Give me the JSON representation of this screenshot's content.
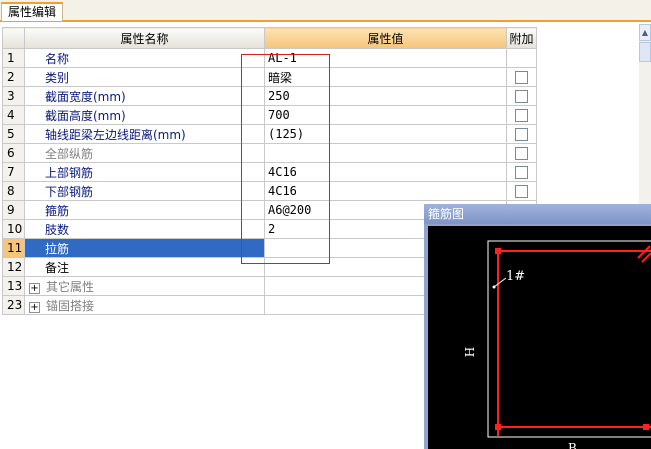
{
  "tab": {
    "label": "属性编辑"
  },
  "grid": {
    "headers": {
      "name": "属性名称",
      "value": "属性值",
      "add": "附加"
    },
    "rows": [
      {
        "num": "1",
        "name": "名称",
        "value": "AL-1"
      },
      {
        "num": "2",
        "name": "类别",
        "value": "暗梁"
      },
      {
        "num": "3",
        "name": "截面宽度(mm)",
        "value": "250"
      },
      {
        "num": "4",
        "name": "截面高度(mm)",
        "value": "700"
      },
      {
        "num": "5",
        "name": "轴线距梁左边线距离(mm)",
        "value": "(125)"
      },
      {
        "num": "6",
        "name": "全部纵筋",
        "value": ""
      },
      {
        "num": "7",
        "name": "上部钢筋",
        "value": "4C16"
      },
      {
        "num": "8",
        "name": "下部钢筋",
        "value": "4C16"
      },
      {
        "num": "9",
        "name": "箍筋",
        "value": "A6@200"
      },
      {
        "num": "10",
        "name": "肢数",
        "value": "2"
      },
      {
        "num": "11",
        "name": "拉筋",
        "value": ""
      },
      {
        "num": "12",
        "name": "备注",
        "value": ""
      },
      {
        "num": "13",
        "name": "其它属性",
        "value": ""
      },
      {
        "num": "23",
        "name": "锚固搭接",
        "value": ""
      }
    ]
  },
  "sketch": {
    "title": "箍筋图",
    "label_h": "H",
    "label_b": "B",
    "label_bar": "1#"
  }
}
